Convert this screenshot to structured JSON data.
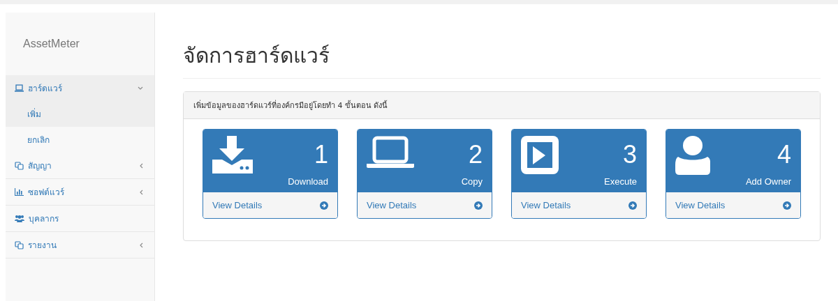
{
  "sidebar": {
    "brand": "AssetMeter",
    "items": [
      {
        "label": "ฮาร์ดแวร์",
        "expanded": true,
        "children": [
          {
            "label": "เพิ่ม",
            "selected": true
          },
          {
            "label": "ยกเลิก",
            "selected": false
          }
        ]
      },
      {
        "label": "สัญญา",
        "expanded": false
      },
      {
        "label": "ซอฟต์แวร์",
        "expanded": false
      },
      {
        "label": "บุคลากร"
      },
      {
        "label": "รายงาน",
        "expanded": false
      }
    ]
  },
  "page": {
    "title": "จัดการฮาร์ดแวร์",
    "panel": {
      "heading": "เพิ่มข้อมูลของฮาร์ดแวร์ที่องค์กรมีอยู่โดยทำ 4 ขั้นตอน ดังนี้",
      "cards": [
        {
          "number": "1",
          "label": "Download",
          "link": "View Details"
        },
        {
          "number": "2",
          "label": "Copy",
          "link": "View Details"
        },
        {
          "number": "3",
          "label": "Execute",
          "link": "View Details"
        },
        {
          "number": "4",
          "label": "Add Owner",
          "link": "View Details"
        }
      ]
    }
  }
}
